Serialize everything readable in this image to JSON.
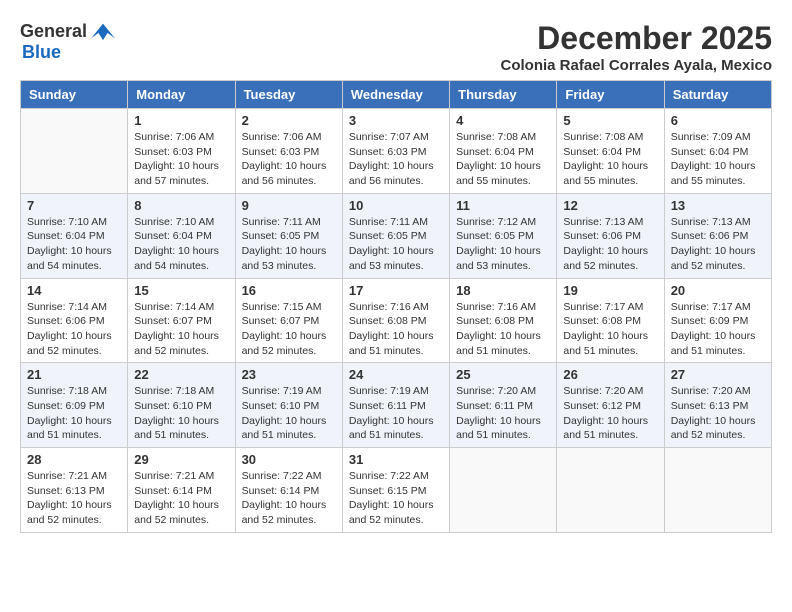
{
  "header": {
    "logo_general": "General",
    "logo_blue": "Blue",
    "month_title": "December 2025",
    "subtitle": "Colonia Rafael Corrales Ayala, Mexico"
  },
  "days_of_week": [
    "Sunday",
    "Monday",
    "Tuesday",
    "Wednesday",
    "Thursday",
    "Friday",
    "Saturday"
  ],
  "weeks": [
    [
      {
        "day": "",
        "info": ""
      },
      {
        "day": "1",
        "info": "Sunrise: 7:06 AM\nSunset: 6:03 PM\nDaylight: 10 hours\nand 57 minutes."
      },
      {
        "day": "2",
        "info": "Sunrise: 7:06 AM\nSunset: 6:03 PM\nDaylight: 10 hours\nand 56 minutes."
      },
      {
        "day": "3",
        "info": "Sunrise: 7:07 AM\nSunset: 6:03 PM\nDaylight: 10 hours\nand 56 minutes."
      },
      {
        "day": "4",
        "info": "Sunrise: 7:08 AM\nSunset: 6:04 PM\nDaylight: 10 hours\nand 55 minutes."
      },
      {
        "day": "5",
        "info": "Sunrise: 7:08 AM\nSunset: 6:04 PM\nDaylight: 10 hours\nand 55 minutes."
      },
      {
        "day": "6",
        "info": "Sunrise: 7:09 AM\nSunset: 6:04 PM\nDaylight: 10 hours\nand 55 minutes."
      }
    ],
    [
      {
        "day": "7",
        "info": "Sunrise: 7:10 AM\nSunset: 6:04 PM\nDaylight: 10 hours\nand 54 minutes."
      },
      {
        "day": "8",
        "info": "Sunrise: 7:10 AM\nSunset: 6:04 PM\nDaylight: 10 hours\nand 54 minutes."
      },
      {
        "day": "9",
        "info": "Sunrise: 7:11 AM\nSunset: 6:05 PM\nDaylight: 10 hours\nand 53 minutes."
      },
      {
        "day": "10",
        "info": "Sunrise: 7:11 AM\nSunset: 6:05 PM\nDaylight: 10 hours\nand 53 minutes."
      },
      {
        "day": "11",
        "info": "Sunrise: 7:12 AM\nSunset: 6:05 PM\nDaylight: 10 hours\nand 53 minutes."
      },
      {
        "day": "12",
        "info": "Sunrise: 7:13 AM\nSunset: 6:06 PM\nDaylight: 10 hours\nand 52 minutes."
      },
      {
        "day": "13",
        "info": "Sunrise: 7:13 AM\nSunset: 6:06 PM\nDaylight: 10 hours\nand 52 minutes."
      }
    ],
    [
      {
        "day": "14",
        "info": "Sunrise: 7:14 AM\nSunset: 6:06 PM\nDaylight: 10 hours\nand 52 minutes."
      },
      {
        "day": "15",
        "info": "Sunrise: 7:14 AM\nSunset: 6:07 PM\nDaylight: 10 hours\nand 52 minutes."
      },
      {
        "day": "16",
        "info": "Sunrise: 7:15 AM\nSunset: 6:07 PM\nDaylight: 10 hours\nand 52 minutes."
      },
      {
        "day": "17",
        "info": "Sunrise: 7:16 AM\nSunset: 6:08 PM\nDaylight: 10 hours\nand 51 minutes."
      },
      {
        "day": "18",
        "info": "Sunrise: 7:16 AM\nSunset: 6:08 PM\nDaylight: 10 hours\nand 51 minutes."
      },
      {
        "day": "19",
        "info": "Sunrise: 7:17 AM\nSunset: 6:08 PM\nDaylight: 10 hours\nand 51 minutes."
      },
      {
        "day": "20",
        "info": "Sunrise: 7:17 AM\nSunset: 6:09 PM\nDaylight: 10 hours\nand 51 minutes."
      }
    ],
    [
      {
        "day": "21",
        "info": "Sunrise: 7:18 AM\nSunset: 6:09 PM\nDaylight: 10 hours\nand 51 minutes."
      },
      {
        "day": "22",
        "info": "Sunrise: 7:18 AM\nSunset: 6:10 PM\nDaylight: 10 hours\nand 51 minutes."
      },
      {
        "day": "23",
        "info": "Sunrise: 7:19 AM\nSunset: 6:10 PM\nDaylight: 10 hours\nand 51 minutes."
      },
      {
        "day": "24",
        "info": "Sunrise: 7:19 AM\nSunset: 6:11 PM\nDaylight: 10 hours\nand 51 minutes."
      },
      {
        "day": "25",
        "info": "Sunrise: 7:20 AM\nSunset: 6:11 PM\nDaylight: 10 hours\nand 51 minutes."
      },
      {
        "day": "26",
        "info": "Sunrise: 7:20 AM\nSunset: 6:12 PM\nDaylight: 10 hours\nand 51 minutes."
      },
      {
        "day": "27",
        "info": "Sunrise: 7:20 AM\nSunset: 6:13 PM\nDaylight: 10 hours\nand 52 minutes."
      }
    ],
    [
      {
        "day": "28",
        "info": "Sunrise: 7:21 AM\nSunset: 6:13 PM\nDaylight: 10 hours\nand 52 minutes."
      },
      {
        "day": "29",
        "info": "Sunrise: 7:21 AM\nSunset: 6:14 PM\nDaylight: 10 hours\nand 52 minutes."
      },
      {
        "day": "30",
        "info": "Sunrise: 7:22 AM\nSunset: 6:14 PM\nDaylight: 10 hours\nand 52 minutes."
      },
      {
        "day": "31",
        "info": "Sunrise: 7:22 AM\nSunset: 6:15 PM\nDaylight: 10 hours\nand 52 minutes."
      },
      {
        "day": "",
        "info": ""
      },
      {
        "day": "",
        "info": ""
      },
      {
        "day": "",
        "info": ""
      }
    ]
  ]
}
